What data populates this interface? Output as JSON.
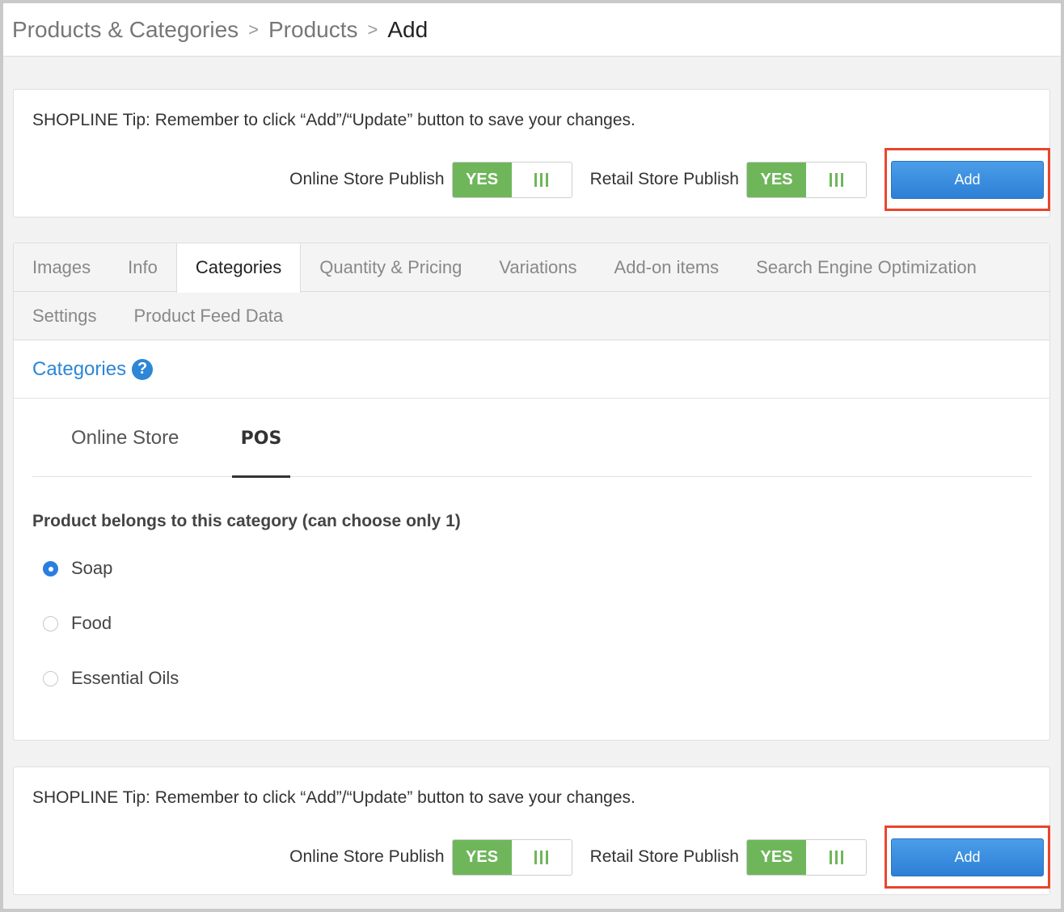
{
  "breadcrumb": {
    "items": [
      "Products & Categories",
      "Products"
    ],
    "current": "Add",
    "separator": ">"
  },
  "tip": {
    "text": "SHOPLINE Tip: Remember to click “Add”/“Update” button to save your changes."
  },
  "publish": {
    "online_label": "Online Store Publish",
    "retail_label": "Retail Store Publish",
    "toggle_on": "YES"
  },
  "add_button": "Add",
  "tabs": {
    "row1": [
      "Images",
      "Info",
      "Categories",
      "Quantity & Pricing",
      "Variations",
      "Add-on items",
      "Search Engine Optimization"
    ],
    "row2": [
      "Settings",
      "Product Feed Data"
    ],
    "active": "Categories"
  },
  "categories": {
    "heading": "Categories",
    "help": "?",
    "subtabs": [
      "Online Store",
      "POS"
    ],
    "active_subtab": "POS",
    "belongs_label": "Product belongs to this category (can choose only 1)",
    "options": [
      "Soap",
      "Food",
      "Essential Oils"
    ],
    "selected": "Soap"
  },
  "colors": {
    "accent": "#2d86d6",
    "toggle_green": "#6fb65b",
    "highlight_red": "#e8452c",
    "button_blue": "#3a8fe0"
  }
}
